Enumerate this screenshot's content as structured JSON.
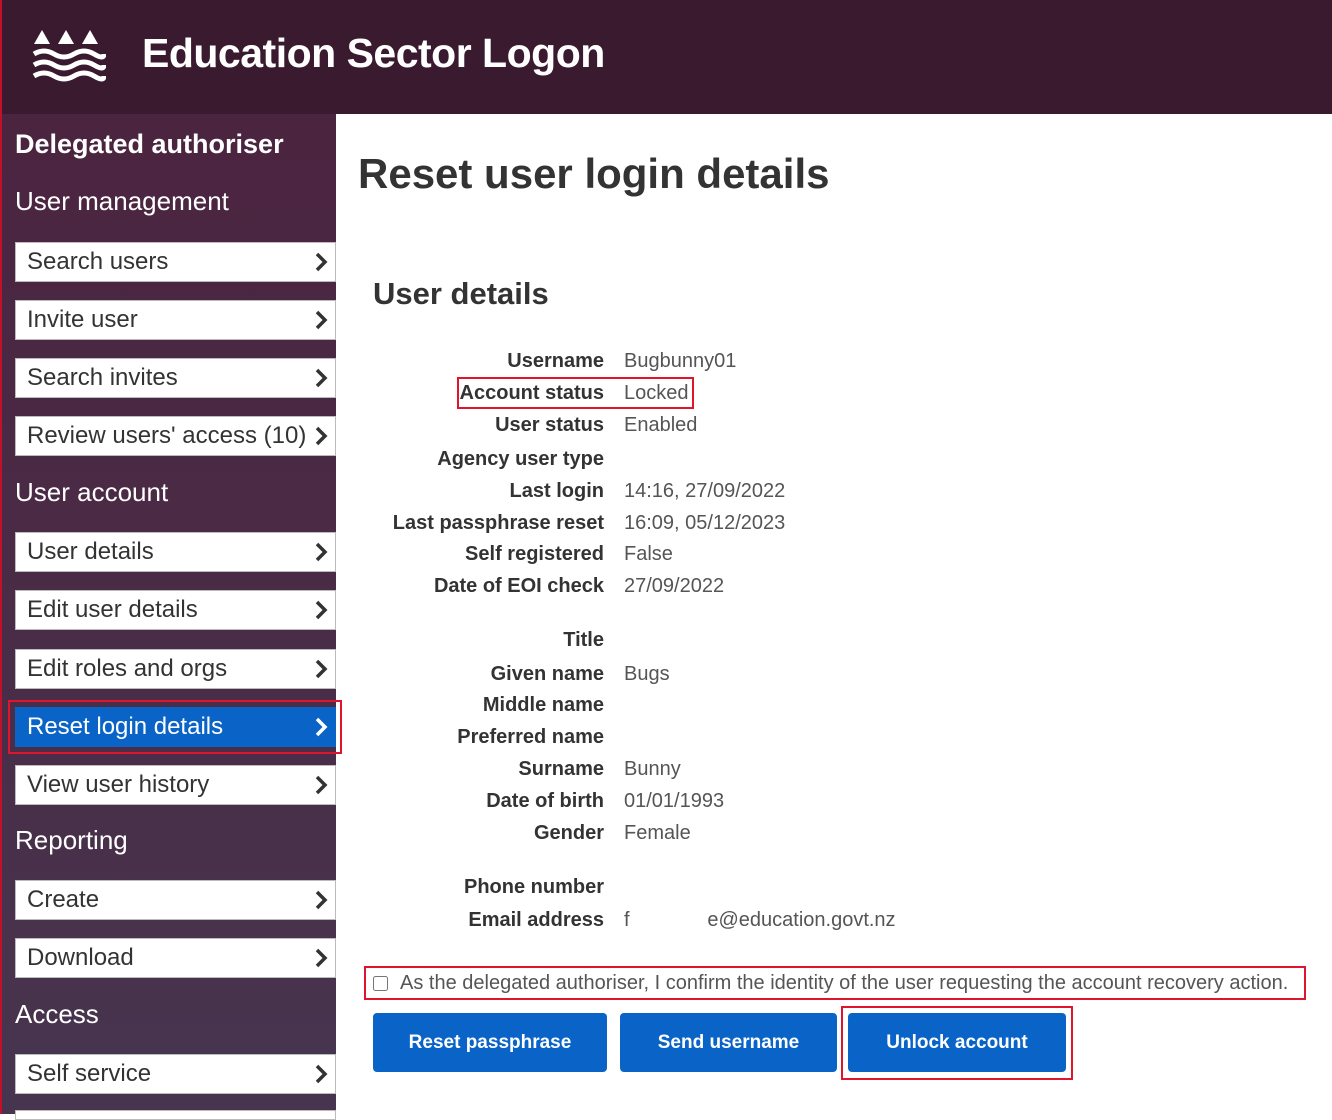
{
  "header": {
    "title": "Education Sector Logon",
    "logo_icon": "waves-mountains-logo"
  },
  "sidebar": {
    "heading": "Delegated authoriser",
    "sections": [
      {
        "title": "User management",
        "items": [
          "Search users",
          "Invite user",
          "Search invites",
          "Review users' access (10)"
        ]
      },
      {
        "title": "User account",
        "items": [
          "User details",
          "Edit user details",
          "Edit roles and orgs",
          "Reset login details",
          "View user history"
        ]
      },
      {
        "title": "Reporting",
        "items": [
          "Create",
          "Download"
        ]
      },
      {
        "title": "Access",
        "items": [
          "Self service"
        ]
      }
    ],
    "active_item": "Reset login details"
  },
  "main": {
    "title": "Reset user login details",
    "section_title": "User details",
    "details": [
      {
        "label": "Username",
        "value": "Bugbunny01"
      },
      {
        "label": "Account status",
        "value": "Locked"
      },
      {
        "label": "User status",
        "value": "Enabled"
      },
      {
        "label": "Agency user type",
        "value": ""
      },
      {
        "label": "Last login",
        "value": "14:16, 27/09/2022"
      },
      {
        "label": "Last passphrase reset",
        "value": "16:09, 05/12/2023"
      },
      {
        "label": "Self registered",
        "value": "False"
      },
      {
        "label": "Date of EOI check",
        "value": "27/09/2022"
      },
      {
        "label": "Title",
        "value": ""
      },
      {
        "label": "Given name",
        "value": "Bugs"
      },
      {
        "label": "Middle name",
        "value": ""
      },
      {
        "label": "Preferred name",
        "value": ""
      },
      {
        "label": "Surname",
        "value": "Bunny"
      },
      {
        "label": "Date of birth",
        "value": "01/01/1993"
      },
      {
        "label": "Gender",
        "value": "Female"
      },
      {
        "label": "Phone number",
        "value": ""
      },
      {
        "label": "Email address",
        "value": "f              e@education.govt.nz"
      }
    ],
    "confirm_text": "As the delegated authoriser, I confirm the identity of the user requesting the account recovery action.",
    "buttons": {
      "reset": "Reset passphrase",
      "send": "Send username",
      "unlock": "Unlock account"
    }
  },
  "colors": {
    "header": "#3a1a2e",
    "accent": "#0a64c8",
    "highlight": "#e0142d"
  }
}
